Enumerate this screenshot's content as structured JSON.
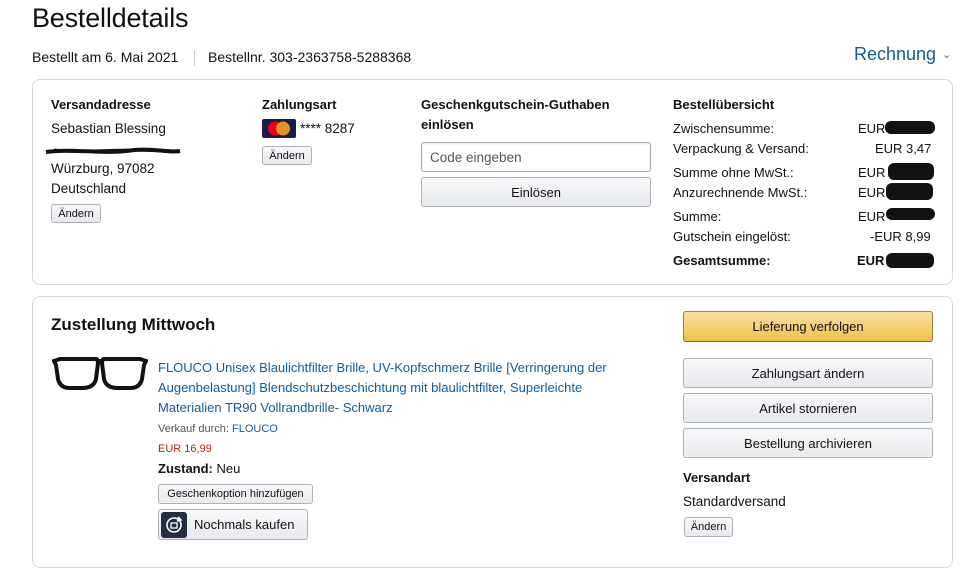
{
  "page": {
    "title": "Bestelldetails",
    "ordered_on": "Bestellt am 6. Mai 2021",
    "order_number": "Bestellnr. 303-2363758-5288368",
    "invoice_link": "Rechnung"
  },
  "summary_box": {
    "shipping": {
      "heading": "Versandadresse",
      "name": "Sebastian Blessing",
      "city": "Würzburg, 97082",
      "country": "Deutschland",
      "change_label": "Ändern"
    },
    "payment": {
      "heading": "Zahlungsart",
      "card_number": "**** 8287",
      "change_label": "Ändern"
    },
    "gift_card": {
      "heading_line1": "Geschenkgutschein-Guthaben",
      "heading_line2": "einlösen",
      "placeholder": "Code eingeben",
      "redeem_label": "Einlösen"
    },
    "order_summary": {
      "heading": "Bestellübersicht",
      "rows": [
        {
          "label": "Zwischensumme:",
          "value": "EUR"
        },
        {
          "label": "Verpackung & Versand:",
          "value": "EUR 3,47"
        },
        {
          "label": "Summe ohne MwSt.:",
          "value": "EUR"
        },
        {
          "label": "Anzurechnende MwSt.:",
          "value": "EUR"
        },
        {
          "label": "Summe:",
          "value": "EUR"
        },
        {
          "label": "Gutschein eingelöst:",
          "value": "-EUR 8,99"
        },
        {
          "label": "Gesamtsumme:",
          "value": "EUR"
        }
      ]
    }
  },
  "shipment": {
    "heading": "Zustellung Mittwoch",
    "product": {
      "title_line1": "FLOUCO Unisex Blaulichtfilter Brille, UV-Kopfschmerz Brille [Verringerung der",
      "title_line2": "Augenbelastung] Blendschutzbeschichtung mit blaulichtfilter, Superleichte",
      "title_line3": "Materialien TR90 Vollrandbrille- Schwarz",
      "sold_by_label": "Verkauf durch:",
      "seller": "FLOUCO",
      "price": "EUR 16,99",
      "condition_label": "Zustand:",
      "condition_value": "Neu",
      "gift_option_label": "Geschenkoption hinzufügen",
      "buy_again_label": "Nochmals kaufen"
    },
    "actions": {
      "track": "Lieferung verfolgen",
      "change_payment": "Zahlungsart ändern",
      "cancel_items": "Artikel stornieren",
      "archive_order": "Bestellung archivieren"
    },
    "shipping_method": {
      "heading": "Versandart",
      "value": "Standardversand",
      "change_label": "Ändern"
    }
  },
  "colors": {
    "link": "#0f5c9d",
    "price": "#b12704",
    "primary_button": "#f0c14b"
  },
  "icons": [
    "mastercard-icon",
    "chevron-down-icon",
    "glasses-product-image",
    "buy-again-icon"
  ]
}
